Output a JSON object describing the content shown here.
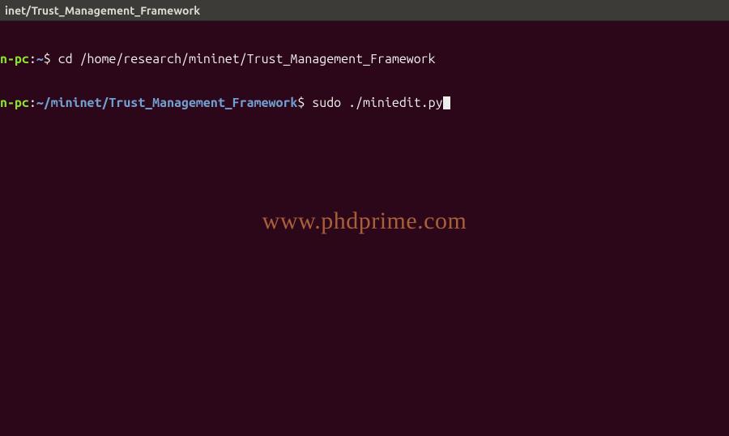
{
  "titlebar": {
    "title": "inet/Trust_Management_Framework"
  },
  "terminal": {
    "lines": [
      {
        "prompt_host": "n-pc",
        "prompt_sep1": ":",
        "prompt_path": "~",
        "prompt_end": "$ ",
        "command": "cd /home/research/mininet/Trust_Management_Framework",
        "cursor": false
      },
      {
        "prompt_host": "n-pc",
        "prompt_sep1": ":",
        "prompt_path": "~/mininet/Trust_Management_Framework",
        "prompt_end": "$ ",
        "command": "sudo ./miniedit.py",
        "cursor": true
      }
    ]
  },
  "watermark": {
    "text": "www.phdprime.com"
  }
}
